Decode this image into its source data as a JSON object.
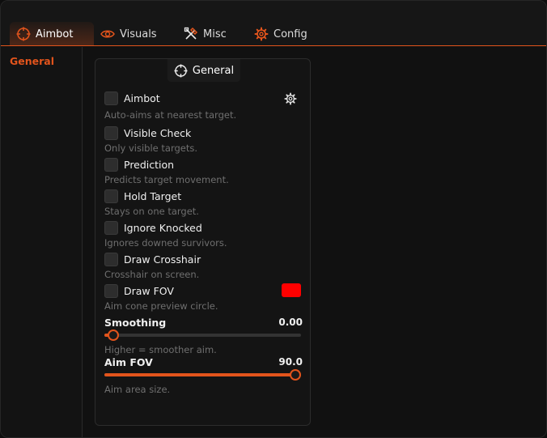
{
  "tabs": [
    {
      "label": "Aimbot",
      "icon": "crosshair-icon",
      "active": true
    },
    {
      "label": "Visuals",
      "icon": "eye-icon",
      "active": false
    },
    {
      "label": "Misc",
      "icon": "tools-icon",
      "active": false
    },
    {
      "label": "Config",
      "icon": "gear-icon",
      "active": false
    }
  ],
  "sidebar": {
    "items": [
      {
        "label": "General",
        "active": true
      }
    ]
  },
  "panel": {
    "title": "General",
    "title_icon": "crosshair-icon",
    "options": [
      {
        "label": "Aimbot",
        "description": "Auto-aims at nearest target.",
        "checked": false,
        "has_settings": true
      },
      {
        "label": "Visible Check",
        "description": "Only visible targets.",
        "checked": false
      },
      {
        "label": "Prediction",
        "description": "Predicts target movement.",
        "checked": false
      },
      {
        "label": "Hold Target",
        "description": "Stays on one target.",
        "checked": false
      },
      {
        "label": "Ignore Knocked",
        "description": "Ignores downed survivors.",
        "checked": false
      },
      {
        "label": "Draw Crosshair",
        "description": "Crosshair on screen.",
        "checked": false
      },
      {
        "label": "Draw FOV",
        "description": "Aim cone preview circle.",
        "checked": false,
        "color": "#ff0000"
      }
    ],
    "sliders": [
      {
        "label": "Smoothing",
        "value": "0.00",
        "fraction": 0.045,
        "description": "Higher = smoother aim."
      },
      {
        "label": "Aim FOV",
        "value": "90.0",
        "fraction": 0.97,
        "description": "Aim area size."
      }
    ]
  },
  "colors": {
    "accent": "#e2541c",
    "background": "#111111",
    "panel": "#141414",
    "muted_text": "#6f6f6f"
  }
}
